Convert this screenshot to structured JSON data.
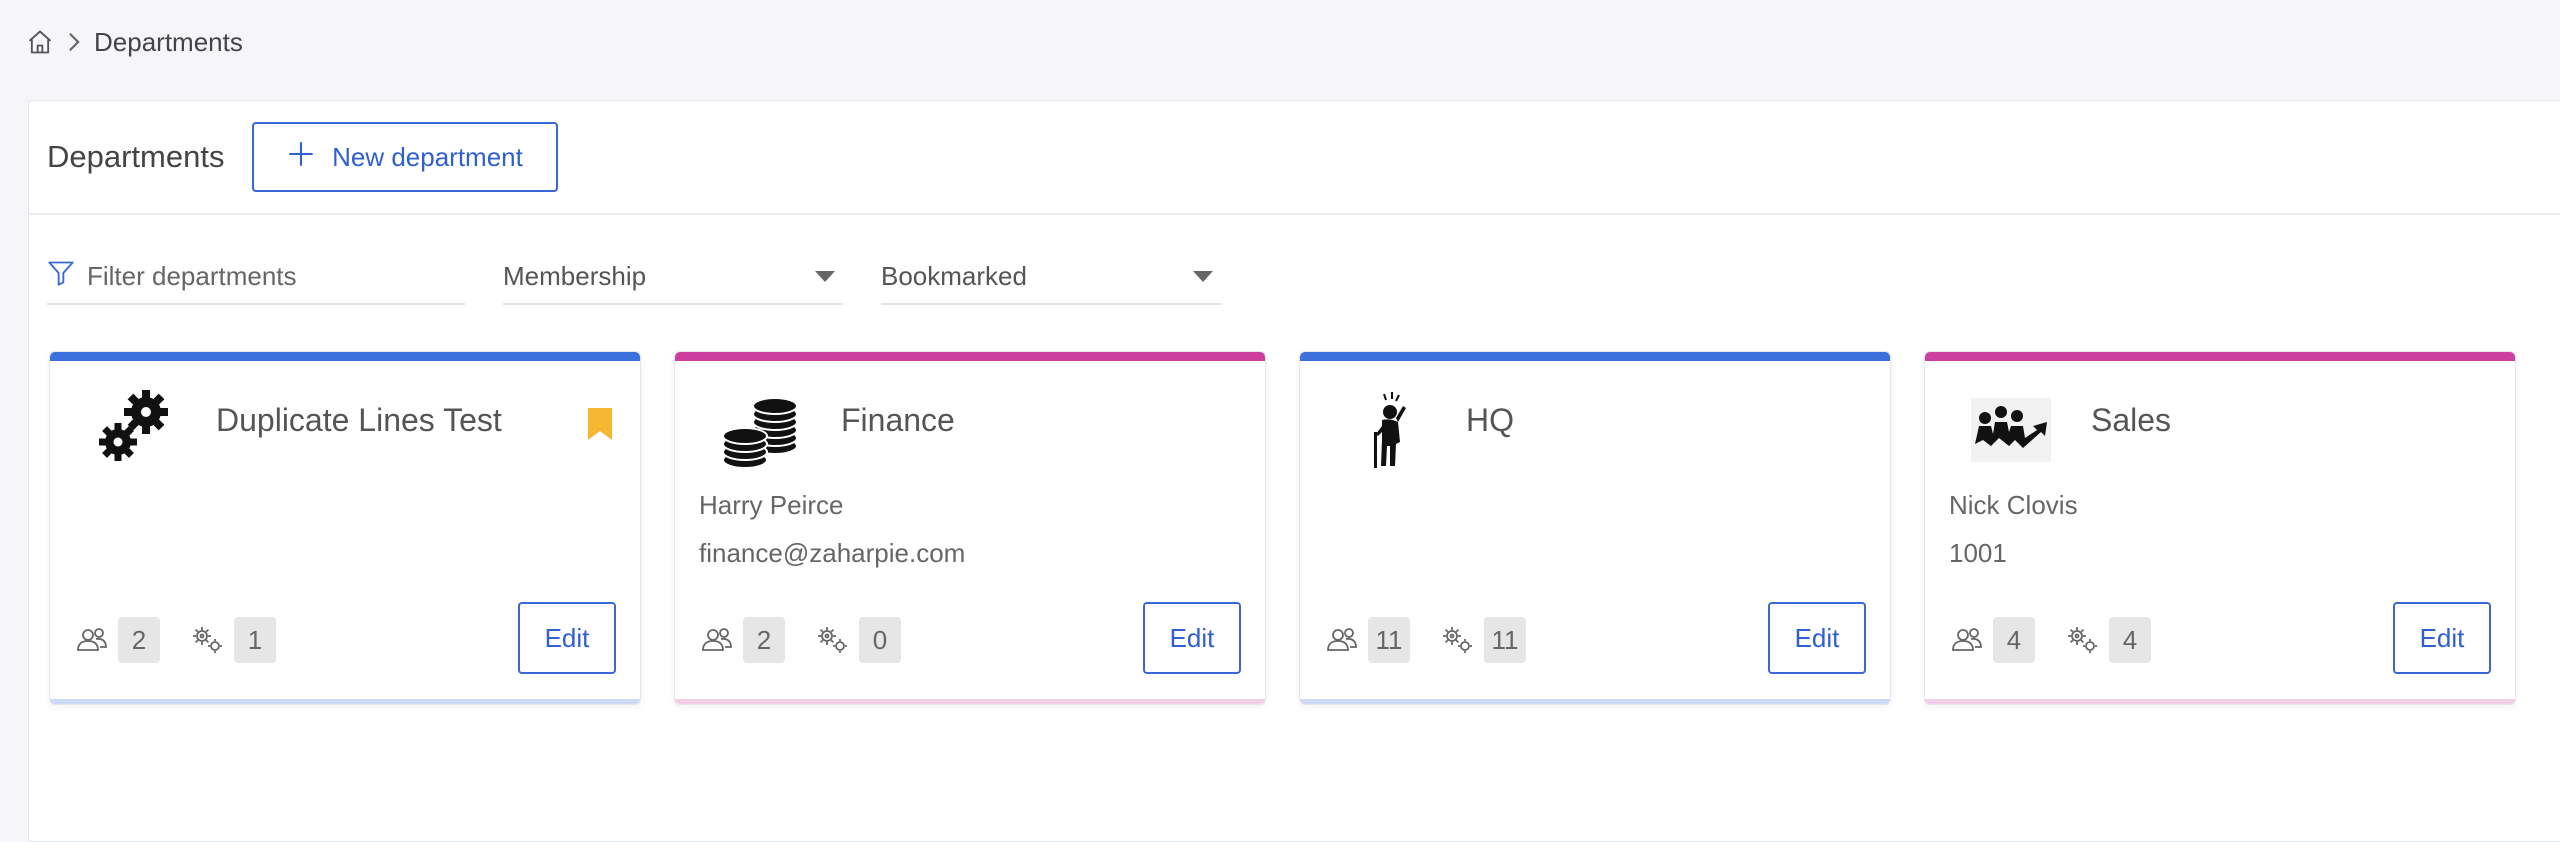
{
  "breadcrumb": {
    "home_icon": "home-icon",
    "separator_icon": "chevron-right-icon",
    "current": "Departments"
  },
  "header": {
    "title": "Departments",
    "new_button_label": "New department"
  },
  "filters": {
    "search_placeholder": "Filter departments",
    "membership_label": "Membership",
    "bookmarked_label": "Bookmarked"
  },
  "colors": {
    "blue": "#3b6fdc",
    "magenta": "#cc3f9e",
    "bookmark": "#f5b731",
    "accent": "#2f5fd0"
  },
  "cards": [
    {
      "name": "Duplicate Lines Test",
      "line1": "",
      "line2": "",
      "members": "2",
      "groups": "1",
      "bookmarked": true,
      "color": "blue",
      "logo": "gears-icon",
      "edit_label": "Edit"
    },
    {
      "name": "Finance",
      "line1": "Harry Peirce",
      "line2": "finance@zaharpie.com",
      "members": "2",
      "groups": "0",
      "bookmarked": false,
      "color": "magenta",
      "logo": "coins-icon",
      "edit_label": "Edit"
    },
    {
      "name": "HQ",
      "line1": "",
      "line2": "",
      "members": "11",
      "groups": "11",
      "bookmarked": false,
      "color": "blue",
      "logo": "confused-person-icon",
      "edit_label": "Edit"
    },
    {
      "name": "Sales",
      "line1": "Nick Clovis",
      "line2": "1001",
      "members": "4",
      "groups": "4",
      "bookmarked": false,
      "color": "magenta",
      "logo": "sales-growth-icon",
      "edit_label": "Edit"
    }
  ]
}
